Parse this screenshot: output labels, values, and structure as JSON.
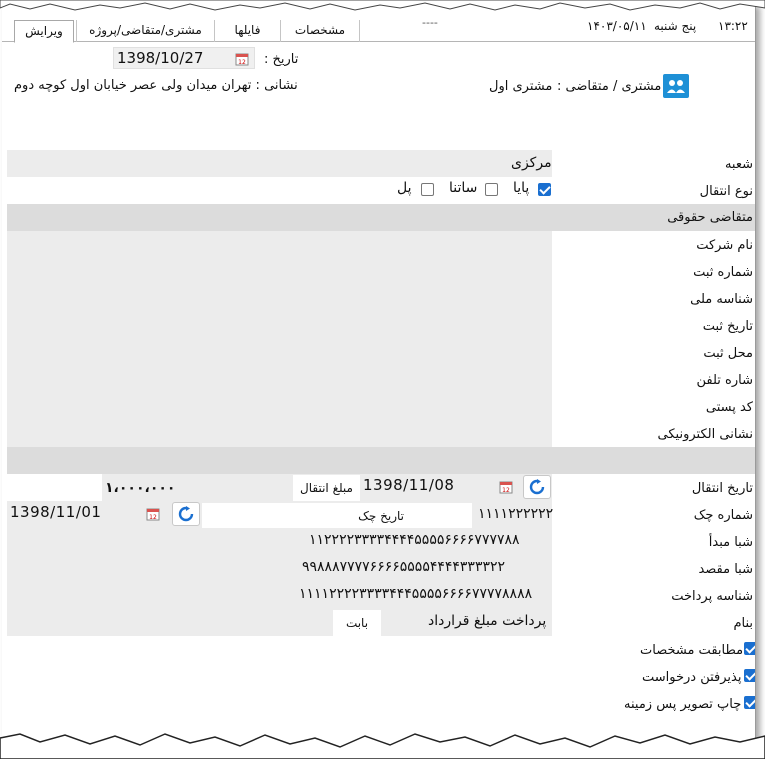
{
  "tabs": {
    "edit": "ویرایش",
    "customer_project": "مشتری/متقاضی/پروژه",
    "files": "فایلها",
    "specs": "مشخصات"
  },
  "status": {
    "time": "۱۳:۲۲",
    "day": "پنج شنبه",
    "date": "۱۴۰۳/۰۵/۱۱",
    "dash": "----"
  },
  "header": {
    "date_label": "تاریخ :",
    "date_value": "1398/10/27",
    "customer_label": "مشتری / متقاضی :",
    "customer_value": "مشتری اول",
    "address": "نشانی : تهران میدان ولی عصر خیابان اول کوچه دوم"
  },
  "form": {
    "branch_label": "شعبه",
    "branch_value": "مرکزی",
    "transfer_type_label": "نوع انتقال",
    "transfer_options": [
      {
        "label": "پایا",
        "checked": true
      },
      {
        "label": "ساتنا",
        "checked": false
      },
      {
        "label": "پل",
        "checked": false
      }
    ],
    "legal_section": "متقاضی حقوقی",
    "company_name_label": "نام شرکت",
    "reg_number_label": "شماره ثبت",
    "national_id_label": "شناسه ملی",
    "reg_date_label": "تاریخ ثبت",
    "reg_place_label": "محل ثبت",
    "phone_label": "شاره تلفن",
    "postal_code_label": "کد پستی",
    "email_label": "نشانی الکترونیکی"
  },
  "transfer": {
    "transfer_date_label": "تاریخ انتقال",
    "transfer_date_value": "1398/11/08",
    "amount_label": "مبلغ انتقال",
    "amount_value": "۱،۰۰۰،۰۰۰",
    "cheque_number_label": "شماره چک",
    "cheque_number_value": "۱۱۱۱۲۲۲۲۲۲",
    "cheque_date_label": "تاریخ چک",
    "cheque_date_value": "1398/11/01",
    "sheba_origin_label": "شبا مبدأ",
    "sheba_origin_value": "۱۱۲۲۲۲۳۳۳۳۴۴۴۴۵۵۵۵۶۶۶۶۷۷۷۷۸۸",
    "sheba_dest_label": "شبا مقصد",
    "sheba_dest_value": "۹۹۸۸۸۷۷۷۷۶۶۶۶۵۵۵۵۴۴۴۴۳۳۳۳۲۲",
    "payment_id_label": "شناسه پرداخت",
    "payment_id_value": "۱۱۱۱۲۲۲۲۳۳۳۳۴۴۴۵۵۵۵۶۶۶۶۷۷۷۷۸۸۸۸",
    "for_label": "بنام",
    "for_value": "پرداخت مبلغ قرارداد",
    "for_suffix": "بابت"
  },
  "options": [
    {
      "label": "مطابقت مشخصات",
      "checked": true
    },
    {
      "label": "پذیرفتن درخواست",
      "checked": true
    },
    {
      "label": "چاپ تصویر پس زمینه",
      "checked": true
    }
  ],
  "colors": {
    "accent": "#1a6fd0",
    "grid_cell": "#ececec",
    "section_band": "#dcdcdc"
  }
}
